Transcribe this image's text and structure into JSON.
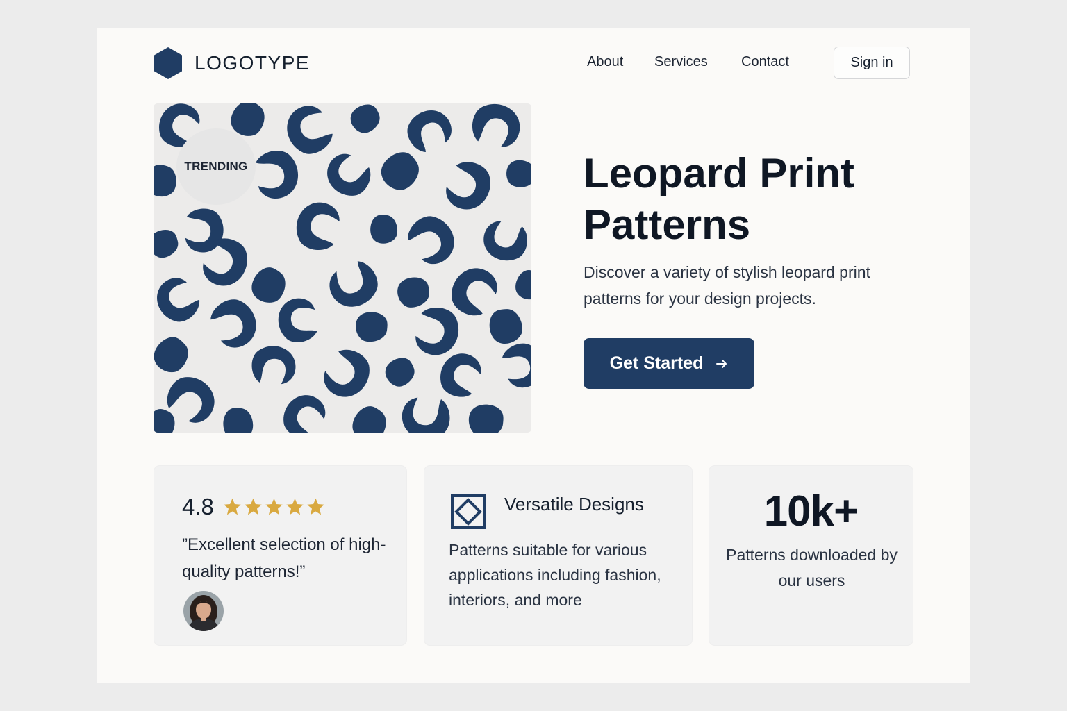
{
  "brand": {
    "logo_text": "LOGOTYPE",
    "logo_icon": "hexagon-icon",
    "primary_color": "#203d64",
    "star_color": "#d9a940"
  },
  "nav": {
    "links": [
      "About",
      "Services",
      "Contact"
    ],
    "sign_in_label": "Sign in"
  },
  "hero": {
    "badge": "TRENDING",
    "title": "Leopard Print Patterns",
    "subtitle": "Discover a variety of stylish leopard print patterns for your design projects.",
    "cta_label": "Get Started",
    "cta_icon": "arrow-right-icon"
  },
  "cards": {
    "review": {
      "rating": "4.8",
      "stars": 5,
      "quote": "”Excellent selection of high-quality patterns!”"
    },
    "feature": {
      "icon": "diamond-frame-icon",
      "title": "Versatile Designs",
      "description": "Patterns suitable for various applications including fashion, interiors, and more"
    },
    "stat": {
      "value": "10k+",
      "label": "Patterns downloaded by our users"
    }
  }
}
